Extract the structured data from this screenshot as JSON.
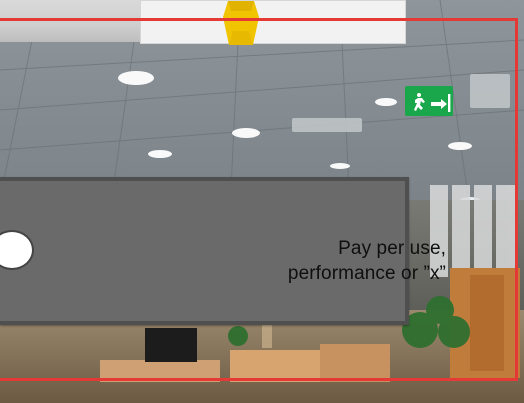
{
  "callout": {
    "line1": "Pay per use,",
    "line2": "performance or ”x”"
  },
  "colors": {
    "red_frame": "#e53935",
    "callout_bg": "#6a6a6a",
    "callout_border": "#4f4f4f",
    "exit_sign": "#1aa64b"
  },
  "icons": [
    "exit-sign-icon",
    "toggle-circle-icon",
    "dress-icon"
  ]
}
